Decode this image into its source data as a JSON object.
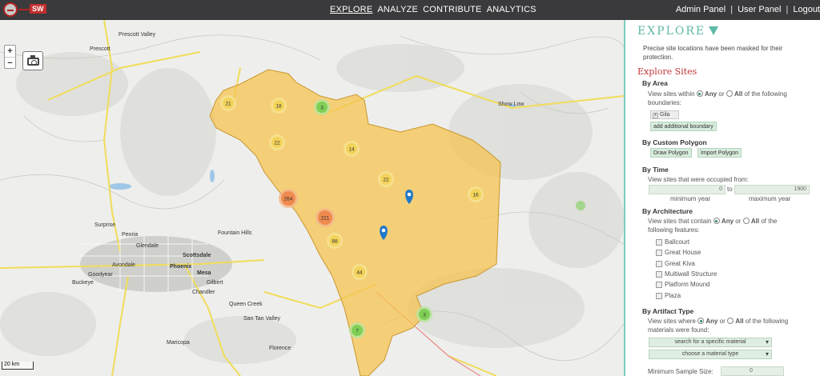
{
  "logo": {
    "text": "SW"
  },
  "nav": {
    "items": [
      "EXPLORE",
      "ANALYZE",
      "CONTRIBUTE",
      "ANALYTICS"
    ],
    "active": "EXPLORE"
  },
  "rightnav": {
    "admin": "Admin Panel",
    "user": "User Panel",
    "logout": "Logout",
    "sep": "|"
  },
  "map": {
    "zoom_in": "+",
    "zoom_out": "−",
    "scale": "20 km",
    "places": [
      "Prescott Valley",
      "Prescott",
      "Surprise",
      "Peoria",
      "Glendale",
      "Scottsdale",
      "Phoenix",
      "Mesa",
      "Gilbert",
      "Chandler",
      "Avondale",
      "Buckeye",
      "Goodyear",
      "Queen Creek",
      "San Tan Valley",
      "Florence",
      "Maricopa",
      "Show Low",
      "Fountain Hills"
    ],
    "clusters": [
      "21",
      "18",
      "3",
      "22",
      "14",
      "22",
      "16",
      "264",
      "221",
      "88",
      "44",
      "3",
      "7"
    ],
    "overlay_color": "#f5c452"
  },
  "panel": {
    "heading": "EXPLORE",
    "subtitle": "Precise site locations have been masked for their protection.",
    "explore_sites": "Explore Sites",
    "by_area": "By Area",
    "view_sites_within": "View sites within",
    "any": "Any",
    "or": "or",
    "all": "All",
    "of_following_boundaries": "of the following",
    "boundaries_word": "boundaries:",
    "boundary_tag": "Gila",
    "add_boundary": "add additional boundary",
    "by_custom_polygon": "By Custom Polygon",
    "draw_polygon": "Draw Polygon",
    "import_polygon": "Import Polygon",
    "by_time": "By Time",
    "time_text": "View sites that were occupied from:",
    "min_year_value": "0",
    "to": "to",
    "max_year_value": "1900",
    "min_year_label": "minimum year",
    "max_year_label": "maximum year",
    "by_architecture": "By Architecture",
    "arch_text": "View sites that contain",
    "arch_features_word": "of the",
    "arch_following": "following features:",
    "features": [
      "Ballcourt",
      "Great House",
      "Great Kiva",
      "Multiwall Structure",
      "Platform Mound",
      "Plaza"
    ],
    "by_artifact_type": "By Artifact Type",
    "artifact_text": "View sites where",
    "artifact_following": "of the following",
    "artifact_materials": "materials were found:",
    "search_material": "search for a specific material",
    "choose_material_type": "choose a material type",
    "min_sample_label": "Minimum Sample Size:",
    "min_sample_value": "0"
  }
}
